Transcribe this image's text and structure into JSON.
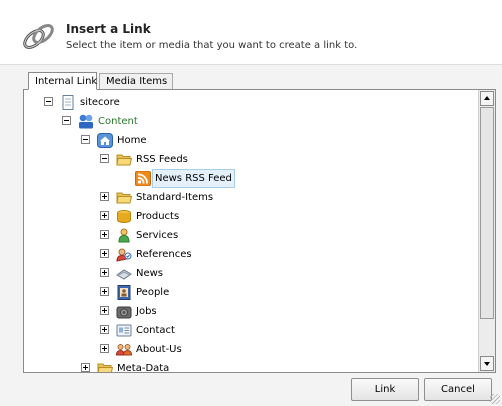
{
  "header": {
    "title": "Insert a Link",
    "subtitle": "Select the item or media that you want to create a link to.",
    "icon": "link-chain-icon"
  },
  "tabs": [
    {
      "label": "Internal Link",
      "active": true
    },
    {
      "label": "Media Items",
      "active": false
    }
  ],
  "tree": {
    "items": [
      {
        "label": "sitecore",
        "icon": "document-icon",
        "expander": "minus"
      },
      {
        "label": "Content",
        "icon": "content-icon",
        "expander": "minus"
      },
      {
        "label": "Home",
        "icon": "home-icon",
        "expander": "minus"
      },
      {
        "label": "RSS Feeds",
        "icon": "folder-icon",
        "expander": "minus"
      },
      {
        "label": "News RSS Feed",
        "icon": "rss-icon",
        "expander": "none",
        "selected": true
      },
      {
        "label": "Standard-Items",
        "icon": "folder-icon",
        "expander": "plus"
      },
      {
        "label": "Products",
        "icon": "box-icon",
        "expander": "plus"
      },
      {
        "label": "Services",
        "icon": "person-icon",
        "expander": "plus"
      },
      {
        "label": "References",
        "icon": "reference-icon",
        "expander": "plus"
      },
      {
        "label": "News",
        "icon": "news-icon",
        "expander": "plus"
      },
      {
        "label": "People",
        "icon": "people-card-icon",
        "expander": "plus"
      },
      {
        "label": "Jobs",
        "icon": "briefcase-icon",
        "expander": "plus"
      },
      {
        "label": "Contact",
        "icon": "contact-card-icon",
        "expander": "plus"
      },
      {
        "label": "About-Us",
        "icon": "group-icon",
        "expander": "plus"
      },
      {
        "label": "Meta-Data",
        "icon": "folder-icon",
        "expander": "plus"
      }
    ]
  },
  "buttons": {
    "link_label": "Link",
    "cancel_label": "Cancel"
  },
  "colors": {
    "content_label": "#2a7a2a",
    "selection_bg": "#e4f1fb",
    "selection_border": "#a9cfe8"
  }
}
